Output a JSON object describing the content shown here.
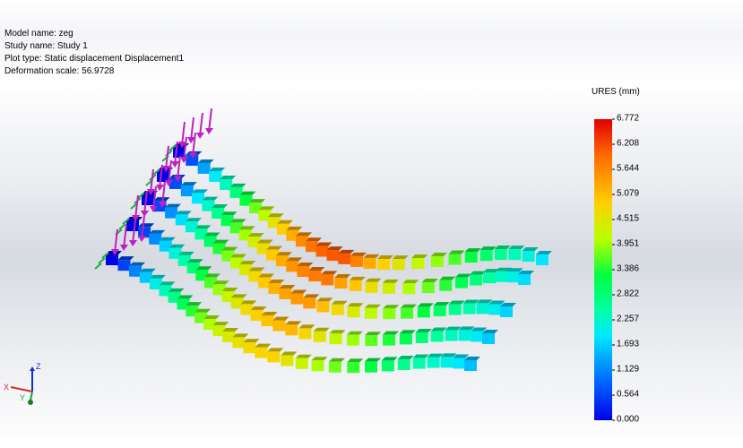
{
  "info": {
    "model_name": "Model name: zeg",
    "study_name": "Study name: Study 1",
    "plot_type": "Plot type: Static displacement Displacement1",
    "deformation_scale": "Deformation scale: 56.9728"
  },
  "legend": {
    "title": "URES (mm)",
    "ticks": [
      "6.772",
      "6.208",
      "5.644",
      "5.079",
      "4.515",
      "3.951",
      "3.386",
      "2.822",
      "2.257",
      "1.693",
      "1.129",
      "0.564",
      "0.000"
    ],
    "max": 6.772,
    "min": 0.0,
    "colormap": [
      "#0000e8",
      "#0070ff",
      "#00e8ff",
      "#00ffaa",
      "#00ff40",
      "#b8ff00",
      "#ffd000",
      "#ff6a00",
      "#e00000"
    ]
  },
  "triad": {
    "x_label": "X",
    "y_label": "Y",
    "z_label": "Z"
  },
  "colors": {
    "load_arrow": "#c020c0",
    "fixture_arrow": "#20b040"
  }
}
